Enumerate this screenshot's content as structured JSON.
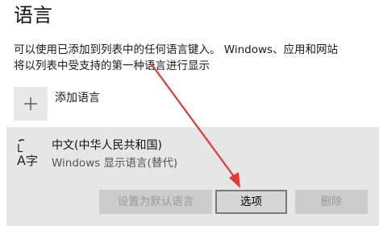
{
  "page": {
    "title": "语言",
    "description_line1": "可以使用已添加到列表中的任何语言键入。 Windows、应用和网站",
    "description_line2": "将以列表中受支持的第一种语言进行显示"
  },
  "add_language": {
    "label": "添加语言",
    "icon": "plus-icon"
  },
  "language_item": {
    "icon": "language-icon",
    "name": "中文(中华人民共和国)",
    "subtitle": "Windows 显示语言(替代)",
    "buttons": {
      "set_default": "设置为默认语言",
      "options": "选项",
      "remove": "删除"
    }
  },
  "annotation": {
    "arrow_color": "#e53935"
  }
}
